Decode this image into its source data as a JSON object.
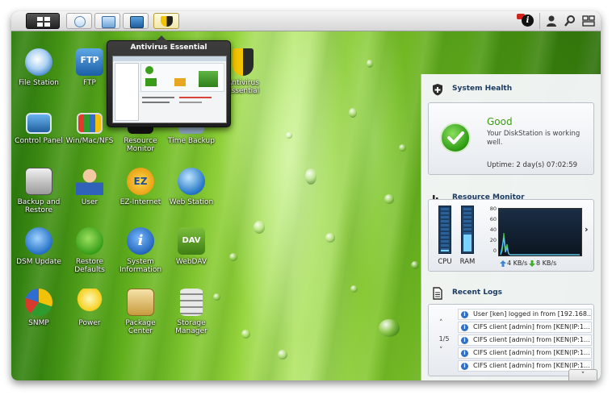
{
  "taskbar": {
    "apps": [
      {
        "name": "file-station",
        "active": false
      },
      {
        "name": "resource-monitor",
        "active": false
      },
      {
        "name": "control-panel",
        "active": false
      },
      {
        "name": "antivirus-essential",
        "active": true
      }
    ]
  },
  "desktop": {
    "icons": [
      {
        "label": "File Station"
      },
      {
        "label": "FTP"
      },
      {
        "label": "Antivirus Essential"
      },
      {
        "label": "Control Panel"
      },
      {
        "label": "Win/Mac/NFS"
      },
      {
        "label": "Resource Monitor"
      },
      {
        "label": "Time Backup"
      },
      {
        "label": "Backup and Restore"
      },
      {
        "label": "User"
      },
      {
        "label": "EZ-Internet"
      },
      {
        "label": "Web Station"
      },
      {
        "label": "DSM Update"
      },
      {
        "label": "Restore Defaults"
      },
      {
        "label": "System Information"
      },
      {
        "label": "WebDAV"
      },
      {
        "label": "SNMP"
      },
      {
        "label": "Power"
      },
      {
        "label": "Package Center"
      },
      {
        "label": "Storage Manager"
      }
    ]
  },
  "popup": {
    "title": "Antivirus Essential"
  },
  "widgets": {
    "health": {
      "title": "System Health",
      "status": "Good",
      "description": "Your DiskStation is working well.",
      "uptime": "Uptime: 2 day(s) 07:02:59"
    },
    "resource": {
      "title": "Resource Monitor",
      "cpu_label": "CPU",
      "ram_label": "RAM",
      "cpu_usage_pct": 3,
      "ram_usage_pct": 38,
      "yticks": [
        "80",
        "60",
        "40",
        "20",
        "0"
      ],
      "upload": "4 KB/s",
      "download": "8 KB/s"
    },
    "logs": {
      "title": "Recent Logs",
      "page": "1/5",
      "entries": [
        "User [ken] logged in from [192.168...",
        "CIFS client [admin] from [KEN(IP:1...",
        "CIFS client [admin] from [KEN(IP:1...",
        "CIFS client [admin] from [KEN(IP:1...",
        "CIFS client [admin] from [KEN(IP:1..."
      ]
    }
  },
  "colors": {
    "accent": "#1b3b63",
    "good": "#3c9a14",
    "badge": "#d2231c"
  }
}
